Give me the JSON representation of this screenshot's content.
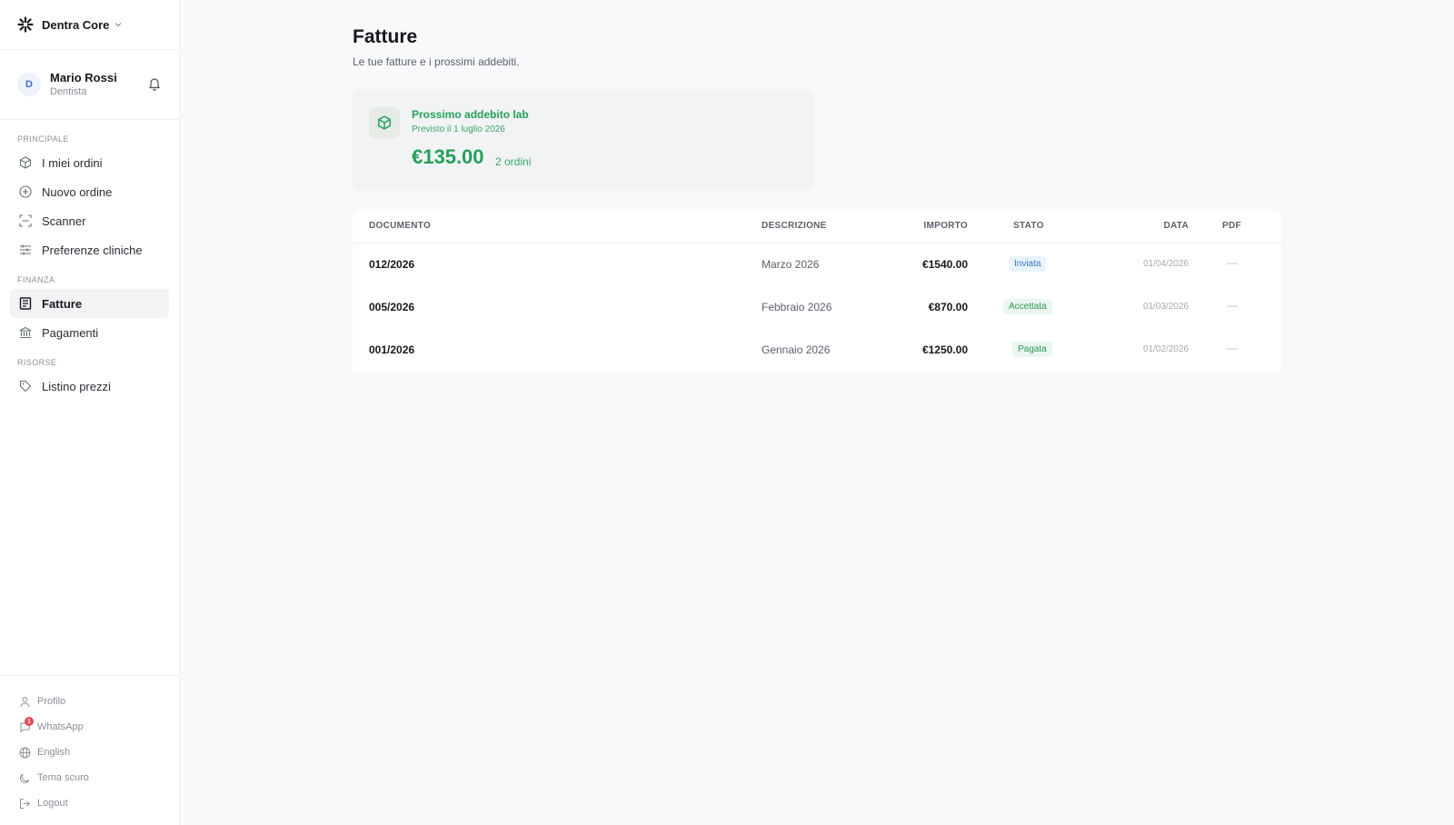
{
  "app": {
    "brand": "Dentra Core"
  },
  "user": {
    "initial": "D",
    "name": "Mario Rossi",
    "role": "Dentista"
  },
  "sidebar": {
    "sections": [
      {
        "label": "PRINCIPALE"
      },
      {
        "label": "FINANZA"
      },
      {
        "label": "RISORSE"
      }
    ],
    "items": [
      {
        "label": "I miei ordini",
        "icon": "box-icon"
      },
      {
        "label": "Nuovo ordine",
        "icon": "plus-circle-icon"
      },
      {
        "label": "Scanner",
        "icon": "scan-icon"
      },
      {
        "label": "Preferenze cliniche",
        "icon": "sliders-icon"
      },
      {
        "label": "Fatture",
        "icon": "invoice-icon",
        "active": true
      },
      {
        "label": "Pagamenti",
        "icon": "bank-icon"
      },
      {
        "label": "Listino prezzi",
        "icon": "tag-icon"
      }
    ],
    "bottom": [
      {
        "label": "Profilo",
        "icon": "user-icon"
      },
      {
        "label": "WhatsApp",
        "icon": "whatsapp-icon",
        "badge": "1"
      },
      {
        "label": "English",
        "icon": "globe-icon"
      },
      {
        "label": "Tema scuro",
        "icon": "moon-icon"
      },
      {
        "label": "Logout",
        "icon": "logout-icon"
      }
    ]
  },
  "page": {
    "title": "Fatture",
    "subtitle": "Le tue fatture e i prossimi addebiti."
  },
  "charge": {
    "title": "Prossimo addebito lab",
    "subtitle": "Previsto il 1 luglio 2026",
    "amount": "€135.00",
    "count": "2 ordini"
  },
  "table": {
    "headers": {
      "document": "DOCUMENTO",
      "description": "DESCRIZIONE",
      "amount": "IMPORTO",
      "status": "STATO",
      "date": "DATA",
      "pdf": "PDF"
    },
    "rows": [
      {
        "document": "012/2026",
        "description": "Marzo 2026",
        "amount": "€1540.00",
        "status": "Inviata",
        "date": "01/04/2026",
        "pdf": "—"
      },
      {
        "document": "005/2026",
        "description": "Febbraio 2026",
        "amount": "€870.00",
        "status": "Accettata",
        "date": "01/03/2026",
        "pdf": "—"
      },
      {
        "document": "001/2026",
        "description": "Gennaio 2026",
        "amount": "€1250.00",
        "status": "Pagata",
        "date": "01/02/2026",
        "pdf": "—"
      }
    ]
  },
  "colors": {
    "accent_green": "#25a05a",
    "status_blue": "#3277c4",
    "badge_red": "#e5484d"
  }
}
